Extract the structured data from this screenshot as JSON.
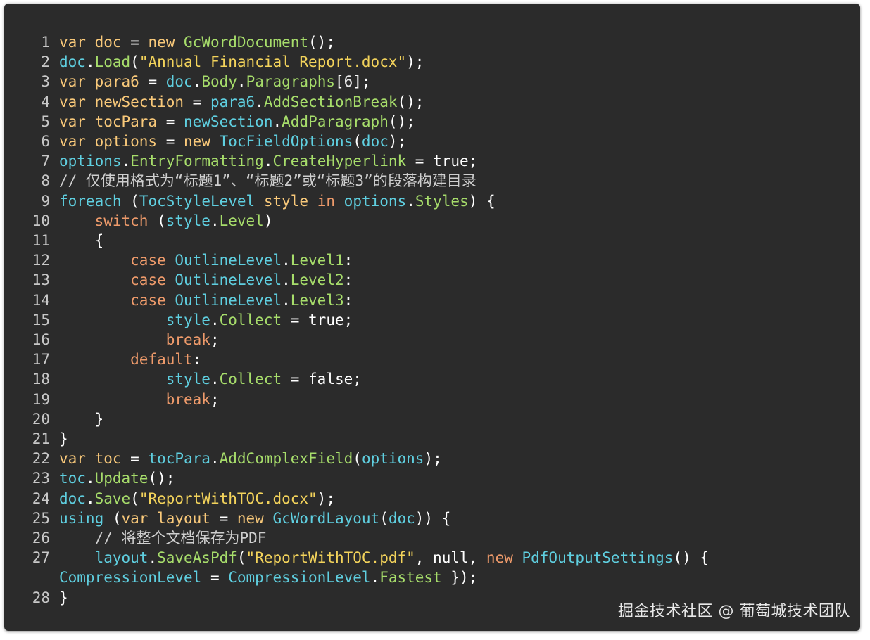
{
  "colors": {
    "background": "#2b2b2b",
    "keyword": "#f9c97a",
    "control_keyword": "#ef9b6b",
    "identifier": "#5fcfe0",
    "method": "#a7dd6b",
    "string": "#f3d35b",
    "plain": "#ffffff"
  },
  "watermark": "掘金技术社区 @ 葡萄城技术团队",
  "code_lines": [
    {
      "n": "1",
      "tokens": [
        [
          "kw",
          "var "
        ],
        [
          "kw",
          "doc"
        ],
        [
          "pl",
          " = "
        ],
        [
          "kw",
          "new "
        ],
        [
          "fn",
          "GcWordDocument"
        ],
        [
          "pl",
          "();"
        ]
      ]
    },
    {
      "n": "2",
      "tokens": [
        [
          "id",
          "doc"
        ],
        [
          "pl",
          "."
        ],
        [
          "fn",
          "Load"
        ],
        [
          "pl",
          "("
        ],
        [
          "str",
          "\"Annual Financial Report.docx\""
        ],
        [
          "pl",
          ");"
        ]
      ]
    },
    {
      "n": "3",
      "tokens": [
        [
          "kw",
          "var "
        ],
        [
          "kw",
          "para6"
        ],
        [
          "pl",
          " = "
        ],
        [
          "id",
          "doc"
        ],
        [
          "pl",
          "."
        ],
        [
          "fn",
          "Body"
        ],
        [
          "pl",
          "."
        ],
        [
          "fn",
          "Paragraphs"
        ],
        [
          "pl",
          "["
        ],
        [
          "num",
          "6"
        ],
        [
          "pl",
          "];"
        ]
      ]
    },
    {
      "n": "4",
      "tokens": [
        [
          "kw",
          "var "
        ],
        [
          "kw",
          "newSection"
        ],
        [
          "pl",
          " = "
        ],
        [
          "id",
          "para6"
        ],
        [
          "pl",
          "."
        ],
        [
          "fn",
          "AddSectionBreak"
        ],
        [
          "pl",
          "();"
        ]
      ]
    },
    {
      "n": "5",
      "tokens": [
        [
          "kw",
          "var "
        ],
        [
          "kw",
          "tocPara"
        ],
        [
          "pl",
          " = "
        ],
        [
          "id",
          "newSection"
        ],
        [
          "pl",
          "."
        ],
        [
          "fn",
          "AddParagraph"
        ],
        [
          "pl",
          "();"
        ]
      ]
    },
    {
      "n": "6",
      "tokens": [
        [
          "kw",
          "var "
        ],
        [
          "kw",
          "options"
        ],
        [
          "pl",
          " = "
        ],
        [
          "kw",
          "new "
        ],
        [
          "id",
          "TocFieldOptions"
        ],
        [
          "pl",
          "("
        ],
        [
          "id",
          "doc"
        ],
        [
          "pl",
          ");"
        ]
      ]
    },
    {
      "n": "7",
      "tokens": [
        [
          "id",
          "options"
        ],
        [
          "pl",
          "."
        ],
        [
          "fn",
          "EntryFormatting"
        ],
        [
          "pl",
          "."
        ],
        [
          "fn",
          "CreateHyperlink"
        ],
        [
          "pl",
          " = true;"
        ]
      ]
    },
    {
      "n": "8",
      "tokens": [
        [
          "com",
          "// 仅使用格式为“标题1”、“标题2”或“标题3”的段落构建目录"
        ]
      ]
    },
    {
      "n": "9",
      "tokens": [
        [
          "id",
          "foreach"
        ],
        [
          "pl",
          " ("
        ],
        [
          "id",
          "TocStyleLevel"
        ],
        [
          "pl",
          " "
        ],
        [
          "kw",
          "style"
        ],
        [
          "pl",
          " "
        ],
        [
          "kw2",
          "in"
        ],
        [
          "pl",
          " "
        ],
        [
          "id",
          "options"
        ],
        [
          "pl",
          "."
        ],
        [
          "fn",
          "Styles"
        ],
        [
          "pl",
          ") {"
        ]
      ]
    },
    {
      "n": "10",
      "tokens": [
        [
          "pl",
          "    "
        ],
        [
          "kw2",
          "switch"
        ],
        [
          "pl",
          " ("
        ],
        [
          "id",
          "style"
        ],
        [
          "pl",
          "."
        ],
        [
          "fn",
          "Level"
        ],
        [
          "pl",
          ")"
        ]
      ]
    },
    {
      "n": "11",
      "tokens": [
        [
          "pl",
          "    {"
        ]
      ]
    },
    {
      "n": "12",
      "tokens": [
        [
          "pl",
          "        "
        ],
        [
          "kw2",
          "case "
        ],
        [
          "id",
          "OutlineLevel"
        ],
        [
          "pl",
          "."
        ],
        [
          "fn",
          "Level1"
        ],
        [
          "pl",
          ":"
        ]
      ]
    },
    {
      "n": "13",
      "tokens": [
        [
          "pl",
          "        "
        ],
        [
          "kw2",
          "case "
        ],
        [
          "id",
          "OutlineLevel"
        ],
        [
          "pl",
          "."
        ],
        [
          "fn",
          "Level2"
        ],
        [
          "pl",
          ":"
        ]
      ]
    },
    {
      "n": "14",
      "tokens": [
        [
          "pl",
          "        "
        ],
        [
          "kw2",
          "case "
        ],
        [
          "id",
          "OutlineLevel"
        ],
        [
          "pl",
          "."
        ],
        [
          "fn",
          "Level3"
        ],
        [
          "pl",
          ":"
        ]
      ]
    },
    {
      "n": "15",
      "tokens": [
        [
          "pl",
          "            "
        ],
        [
          "id",
          "style"
        ],
        [
          "pl",
          "."
        ],
        [
          "fn",
          "Collect"
        ],
        [
          "pl",
          " = true;"
        ]
      ]
    },
    {
      "n": "16",
      "tokens": [
        [
          "pl",
          "            "
        ],
        [
          "kw2",
          "break"
        ],
        [
          "pl",
          ";"
        ]
      ]
    },
    {
      "n": "17",
      "tokens": [
        [
          "pl",
          "        "
        ],
        [
          "kw2",
          "default"
        ],
        [
          "pl",
          ":"
        ]
      ]
    },
    {
      "n": "18",
      "tokens": [
        [
          "pl",
          "            "
        ],
        [
          "id",
          "style"
        ],
        [
          "pl",
          "."
        ],
        [
          "fn",
          "Collect"
        ],
        [
          "pl",
          " = false;"
        ]
      ]
    },
    {
      "n": "19",
      "tokens": [
        [
          "pl",
          "            "
        ],
        [
          "kw2",
          "break"
        ],
        [
          "pl",
          ";"
        ]
      ]
    },
    {
      "n": "20",
      "tokens": [
        [
          "pl",
          "    }"
        ]
      ]
    },
    {
      "n": "21",
      "tokens": [
        [
          "pl",
          "}"
        ]
      ]
    },
    {
      "n": "22",
      "tokens": [
        [
          "kw",
          "var "
        ],
        [
          "kw",
          "toc"
        ],
        [
          "pl",
          " = "
        ],
        [
          "id",
          "tocPara"
        ],
        [
          "pl",
          "."
        ],
        [
          "fn",
          "AddComplexField"
        ],
        [
          "pl",
          "("
        ],
        [
          "id",
          "options"
        ],
        [
          "pl",
          ");"
        ]
      ]
    },
    {
      "n": "23",
      "tokens": [
        [
          "id",
          "toc"
        ],
        [
          "pl",
          "."
        ],
        [
          "fn",
          "Update"
        ],
        [
          "pl",
          "();"
        ]
      ]
    },
    {
      "n": "24",
      "tokens": [
        [
          "id",
          "doc"
        ],
        [
          "pl",
          "."
        ],
        [
          "fn",
          "Save"
        ],
        [
          "pl",
          "("
        ],
        [
          "str",
          "\"ReportWithTOC.docx\""
        ],
        [
          "pl",
          ");"
        ]
      ]
    },
    {
      "n": "25",
      "tokens": [
        [
          "id",
          "using"
        ],
        [
          "pl",
          " ("
        ],
        [
          "kw",
          "var "
        ],
        [
          "kw",
          "layout"
        ],
        [
          "pl",
          " = "
        ],
        [
          "kw",
          "new "
        ],
        [
          "id",
          "GcWordLayout"
        ],
        [
          "pl",
          "("
        ],
        [
          "id",
          "doc"
        ],
        [
          "pl",
          ")) {"
        ]
      ]
    },
    {
      "n": "26",
      "tokens": [
        [
          "pl",
          "    "
        ],
        [
          "com",
          "// 将整个文档保存为PDF"
        ]
      ]
    },
    {
      "n": "27",
      "tokens": [
        [
          "pl",
          "    "
        ],
        [
          "id",
          "layout"
        ],
        [
          "pl",
          "."
        ],
        [
          "fn",
          "SaveAsPdf"
        ],
        [
          "pl",
          "("
        ],
        [
          "str",
          "\"ReportWithTOC.pdf\""
        ],
        [
          "pl",
          ", null, "
        ],
        [
          "kw2",
          "new "
        ],
        [
          "id",
          "PdfOutputSettings"
        ],
        [
          "pl",
          "() {"
        ]
      ]
    },
    {
      "n": "",
      "tokens": [
        [
          "id",
          "CompressionLevel"
        ],
        [
          "pl",
          " = "
        ],
        [
          "id",
          "CompressionLevel"
        ],
        [
          "pl",
          "."
        ],
        [
          "fn",
          "Fastest"
        ],
        [
          "pl",
          " });"
        ]
      ]
    },
    {
      "n": "28",
      "tokens": [
        [
          "pl",
          "}"
        ]
      ]
    }
  ]
}
